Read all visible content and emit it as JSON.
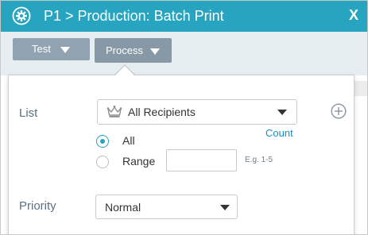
{
  "window": {
    "title": "P1 > Production: Batch Print",
    "close_label": "X"
  },
  "toolbar": {
    "test_label": "Test",
    "process_label": "Process"
  },
  "form": {
    "list_label": "List",
    "list_value": "All Recipients",
    "count_link": "Count",
    "radio_all_label": "All",
    "radio_range_label": "Range",
    "selected_option": "All",
    "range_value": "",
    "range_hint": "E.g. 1-5",
    "priority_label": "Priority",
    "priority_value": "Normal"
  },
  "icons": {
    "app": "gear-icon",
    "list": "crown-icon",
    "add": "plus-circle-icon"
  },
  "colors": {
    "accent": "#27a4bf",
    "toolbar_button": "#91a3b1",
    "link": "#1a8fc4",
    "label": "#5a7184"
  }
}
